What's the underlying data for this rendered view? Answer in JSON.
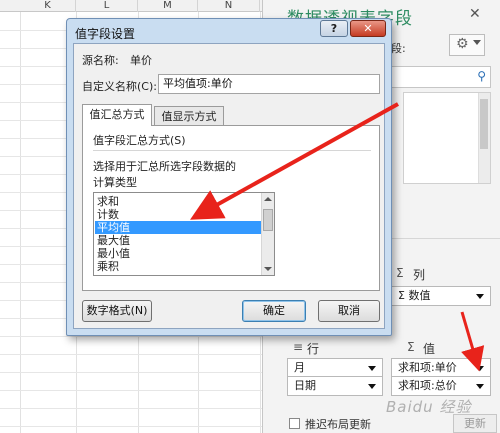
{
  "sheet": {
    "columns": [
      "K",
      "L",
      "M",
      "N"
    ]
  },
  "pane": {
    "title": "数据透视表字段",
    "subtitle": "段:",
    "columns_label": "列",
    "columns_value": "数值",
    "rows_label": "行",
    "values_label": "值",
    "row_fields": [
      "月",
      "日期"
    ],
    "value_fields": [
      "求和项:单价",
      "求和项:总价"
    ],
    "defer_label": "推迟布局更新",
    "update_label": "更新"
  },
  "dialog": {
    "title": "值字段设置",
    "help_label": "?",
    "close_label": "✕",
    "source_label": "源名称:",
    "source_value": "单价",
    "custom_name_label": "自定义名称(C):",
    "custom_name_value": "平均值项:单价",
    "tabs": [
      {
        "label": "值汇总方式"
      },
      {
        "label": "值显示方式"
      }
    ],
    "group_label": "值字段汇总方式(S)",
    "description": "选择用于汇总所选字段数据的",
    "calc_type_label": "计算类型",
    "calc_options": [
      "求和",
      "计数",
      "平均值",
      "最大值",
      "最小值",
      "乘积"
    ],
    "selected_option": "平均值",
    "number_format_label": "数字格式(N)",
    "ok_label": "确定",
    "cancel_label": "取消"
  },
  "watermark": "Baidu 经验",
  "colors": {
    "accent_green": "#2e8c62",
    "arrow_red": "#e8231b",
    "selection_blue": "#3399ff"
  }
}
